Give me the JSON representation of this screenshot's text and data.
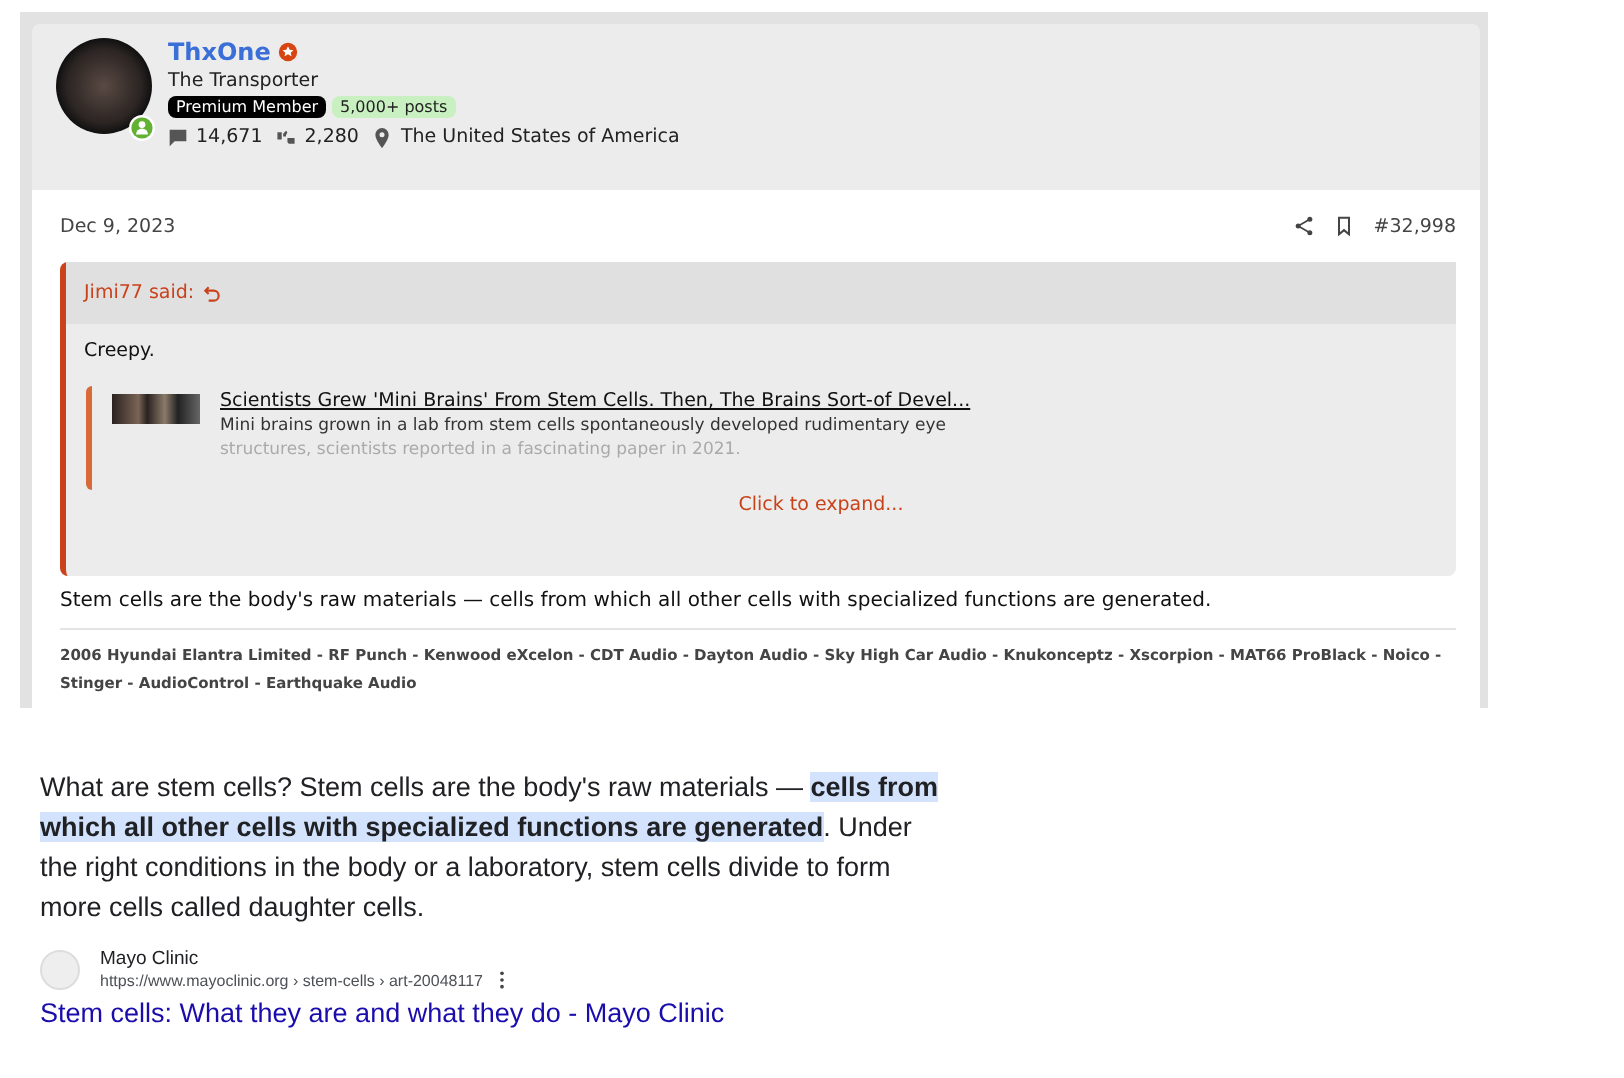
{
  "post": {
    "user": {
      "name": "ThxOne",
      "title": "The Transporter",
      "online": true,
      "badges": [
        {
          "label": "Premium Member",
          "kind": "premium"
        },
        {
          "label": "5,000+ posts",
          "kind": "posts"
        }
      ],
      "messages": "14,671",
      "reactions": "2,280",
      "location": "The United States of America"
    },
    "date": "Dec 9, 2023",
    "number": "#32,998",
    "quote": {
      "author": "Jimi77 said:",
      "text": "Creepy.",
      "embed": {
        "title": "Scientists Grew 'Mini Brains' From Stem Cells. Then, The Brains Sort-of Devel...",
        "line1": "Mini brains grown in a lab from stem cells spontaneously developed rudimentary eye",
        "line2": "structures, scientists reported in a fascinating paper in 2021."
      },
      "expand": "Click to expand..."
    },
    "body": "Stem cells are the body's raw materials — cells from which all other cells with specialized functions are generated.",
    "signature": "2006 Hyundai Elantra Limited - RF Punch - Kenwood eXcelon - CDT Audio - Dayton Audio - Sky High Car Audio - Knukonceptz - Xscorpion - MAT66 ProBlack - Noico - Stinger - AudioControl - Earthquake Audio"
  },
  "snippet": {
    "before": "What are stem cells? Stem cells are the body's raw materials — ",
    "highlight": "cells from which all other cells with specialized functions are generated",
    "after": ". Under the right conditions in the body or a laboratory, stem cells divide to form more cells called daughter cells.",
    "source": {
      "name": "Mayo Clinic",
      "url": "https://www.mayoclinic.org › stem-cells › art-20048117"
    },
    "link": "Stem cells: What they are and what they do - Mayo Clinic"
  }
}
